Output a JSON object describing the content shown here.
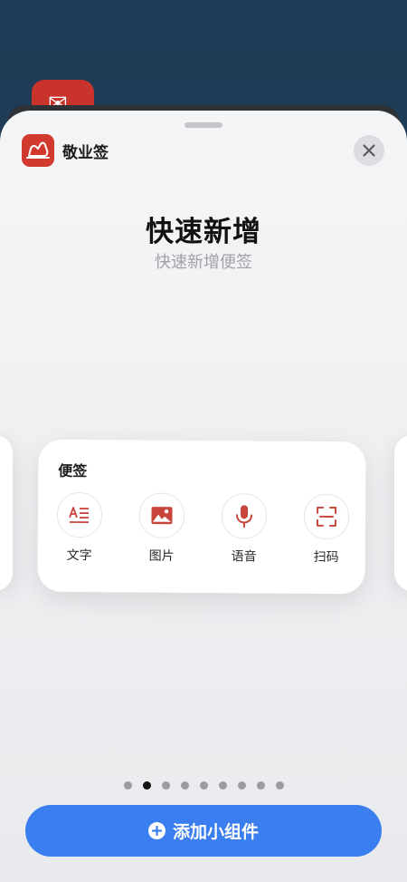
{
  "background": {
    "app_icon": "mail-icon"
  },
  "sheet": {
    "app_name": "敬业签",
    "app_icon": "cloud-note-logo-icon",
    "close_icon": "close-icon"
  },
  "widget": {
    "title": "快速新增",
    "subtitle": "快速新增便签",
    "card_label": "便签",
    "actions": [
      {
        "label": "文字",
        "icon": "text-icon"
      },
      {
        "label": "图片",
        "icon": "image-icon"
      },
      {
        "label": "语音",
        "icon": "microphone-icon"
      },
      {
        "label": "扫码",
        "icon": "scan-icon"
      }
    ]
  },
  "pagination": {
    "total": 9,
    "current": 2
  },
  "add_button": {
    "label": "添加小组件",
    "icon": "plus-circle-icon"
  },
  "colors": {
    "brand_red": "#d33a2f",
    "accent_blue": "#3b7ef0",
    "icon_red": "#c8453b"
  }
}
